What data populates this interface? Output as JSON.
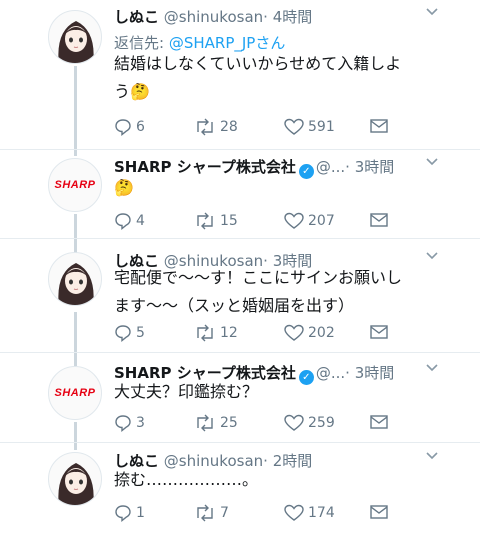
{
  "tweets": [
    {
      "author": "しぬこ",
      "handle": "@shinukosan",
      "time": "· 4時間",
      "reply_prefix": "返信先: ",
      "reply_mention": "@SHARP_JPさん",
      "text_lines": [
        "結婚はしなくていいからせめて入籍しよ",
        "う🤔"
      ],
      "replies": "6",
      "retweets": "28",
      "likes": "591"
    },
    {
      "author": "SHARP シャープ株式会社",
      "handle": "@...",
      "time": "· 3時間",
      "logo": "SHARP",
      "text_lines": [
        "🤔"
      ],
      "replies": "4",
      "retweets": "15",
      "likes": "207"
    },
    {
      "author": "しぬこ",
      "handle": "@shinukosan",
      "time": "· 3時間",
      "text_lines": [
        "宅配便で〜〜す！ここにサインお願いし",
        "ます〜〜（スッと婚姻届を出す）"
      ],
      "replies": "5",
      "retweets": "12",
      "likes": "202"
    },
    {
      "author": "SHARP シャープ株式会社",
      "handle": "@...",
      "time": "· 3時間",
      "logo": "SHARP",
      "text_lines": [
        "大丈夫？印鑑捺む？"
      ],
      "replies": "3",
      "retweets": "25",
      "likes": "259"
    },
    {
      "author": "しぬこ",
      "handle": "@shinukosan",
      "time": "· 2時間",
      "text_lines": [
        "捺む………………。"
      ],
      "replies": "1",
      "retweets": "7",
      "likes": "174"
    }
  ],
  "colors": {
    "link": "#1da1f2",
    "muted": "#657786",
    "sharp_red": "#e60012"
  }
}
